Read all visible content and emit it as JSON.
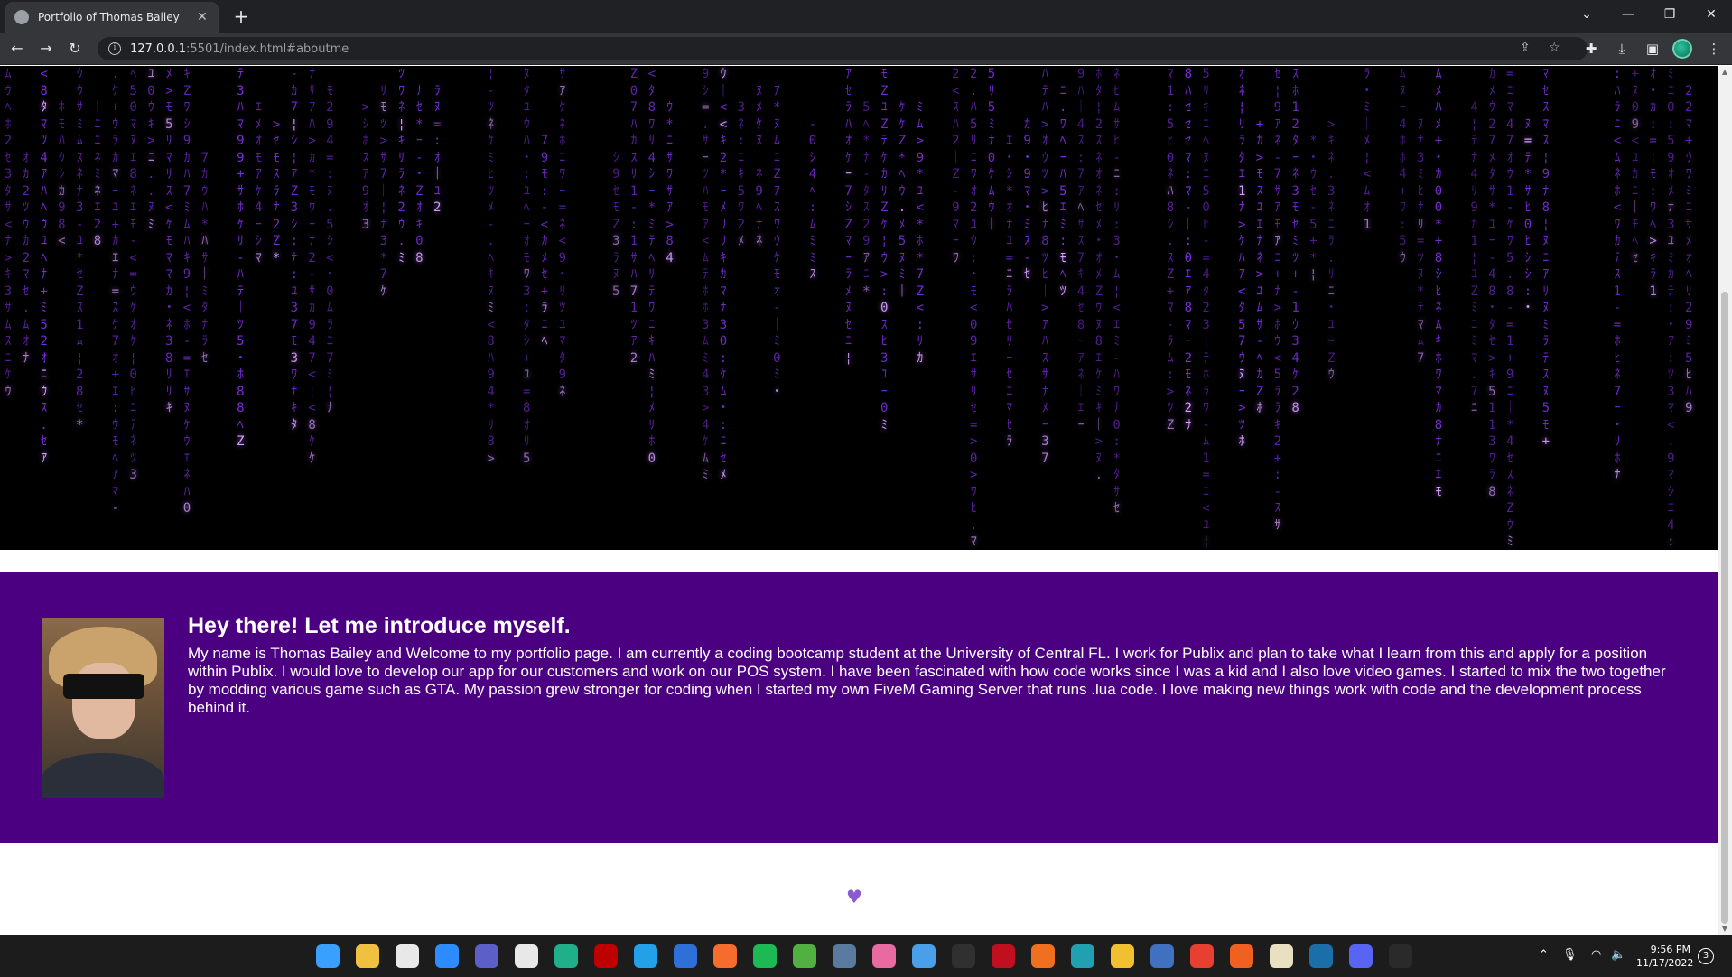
{
  "browser": {
    "tab_title": "Portfolio of Thomas Bailey",
    "tab_close": "✕",
    "new_tab": "+",
    "url_host": "127.0.0.1",
    "url_rest": ":5501/index.html#aboutme"
  },
  "about": {
    "title": "Hey there! Let me introduce myself.",
    "text": "My name is Thomas Bailey and Welcome to my portfolio page. I am currently a coding bootcamp student at the University of Central FL. I work for Publix and plan to take what I learn from this and apply for a position within Publix. I would love to develop our app for our customers and work on our POS system. I have been fascinated with how code works since I was a kid and I also love video games. I started to mix the two together by modding various game such as GTA. My passion grew stronger for coding when I started my own FiveM Gaming Server that runs .lua code. I love making new things work with code and the development process behind it."
  },
  "footer": {
    "heart": "♥"
  },
  "matrix": {
    "accent": "#7d2ee0",
    "glyphs": "ﾊﾐﾋｰｳｼﾅﾓﾆｻﾜﾂｵﾘｱﾎﾃﾏｹﾒｴｶｷﾑﾕﾗｾﾈｽﾀﾇﾍ012345789Z:・.=*+-<>¦｜"
  },
  "taskbar": {
    "time": "9:56 PM",
    "date": "11/17/2022",
    "notifications": "3",
    "icons": [
      {
        "name": "windows-start-icon",
        "color": "#3aa0ff"
      },
      {
        "name": "git-icon",
        "color": "#f0c040"
      },
      {
        "name": "slack-icon",
        "color": "#e8e8e8"
      },
      {
        "name": "zoom-icon",
        "color": "#2d8cff"
      },
      {
        "name": "teams-icon",
        "color": "#5b5fc7"
      },
      {
        "name": "acrobat-icon",
        "color": "#e8e8e8"
      },
      {
        "name": "gitkraken-icon",
        "color": "#1fb08a"
      },
      {
        "name": "filezilla-icon",
        "color": "#bf0000"
      },
      {
        "name": "vscode-icon",
        "color": "#22a0e8"
      },
      {
        "name": "edge-icon",
        "color": "#2f6fd8"
      },
      {
        "name": "origin-icon",
        "color": "#f56c2d"
      },
      {
        "name": "spotify-icon",
        "color": "#1db954"
      },
      {
        "name": "xbox-icon",
        "color": "#52b043"
      },
      {
        "name": "calculator-icon",
        "color": "#5a7aa0"
      },
      {
        "name": "photos-icon",
        "color": "#e86aa0"
      },
      {
        "name": "whiteboard-icon",
        "color": "#4aa0e8"
      },
      {
        "name": "keyboard-app-icon",
        "color": "#303030"
      },
      {
        "name": "f1-game-icon",
        "color": "#c01020"
      },
      {
        "name": "nodes-icon",
        "color": "#f07020"
      },
      {
        "name": "waveform-icon",
        "color": "#20a0b0"
      },
      {
        "name": "file-explorer-icon",
        "color": "#f0c030"
      },
      {
        "name": "task-manager-icon",
        "color": "#4070c0"
      },
      {
        "name": "chrome-icon",
        "color": "#e84030"
      },
      {
        "name": "firefox-icon",
        "color": "#f06020"
      },
      {
        "name": "notepad-icon",
        "color": "#e8e0c0"
      },
      {
        "name": "steam-icon",
        "color": "#1b6ea8"
      },
      {
        "name": "discord-icon",
        "color": "#5865f2"
      },
      {
        "name": "terminal-icon",
        "color": "#2a2a2a"
      }
    ]
  }
}
